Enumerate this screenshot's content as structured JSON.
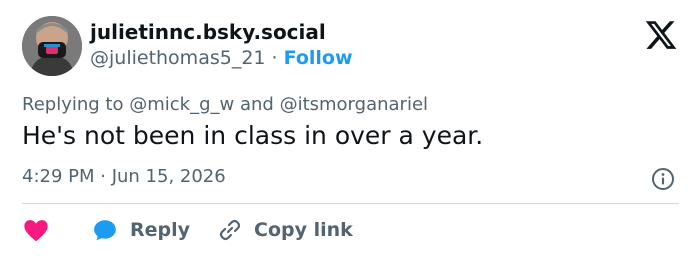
{
  "author": {
    "display_name": "julietinnc.bsky.social",
    "handle": "@juliethomas5_21",
    "separator": "·",
    "follow_label": "Follow",
    "avatar_icon": "user-avatar-masked"
  },
  "reply_context": {
    "prefix": "Replying to",
    "mention_1": "@mick_g_w",
    "conjunction": "and",
    "mention_2": "@itsmorganariel"
  },
  "post": {
    "text": "He's not been in class in over a year.",
    "timestamp": "4:29 PM · Jun 15, 2026"
  },
  "actions": {
    "like_icon": "heart-icon",
    "reply_label": "Reply",
    "copy_link_label": "Copy link"
  },
  "icons": {
    "brand": "x-logo-icon",
    "info": "info-icon"
  },
  "colors": {
    "accent": "#1d9bf0",
    "heart": "#f91880",
    "muted": "#536471",
    "text": "#0f1419",
    "divider": "#cfd9de"
  }
}
